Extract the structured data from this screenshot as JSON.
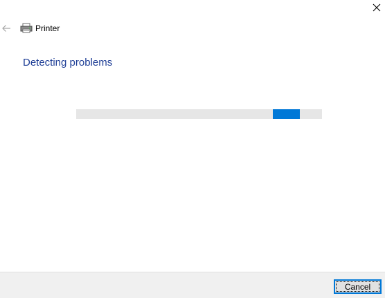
{
  "window": {
    "close_icon": "close-icon",
    "back_icon": "back-arrow-icon",
    "app_icon": "printer-icon",
    "title": "Printer"
  },
  "main": {
    "heading": "Detecting problems",
    "progress": {
      "state": "indeterminate",
      "chunk_position_fraction": 0.8,
      "track_color": "#e6e6e6",
      "fill_color": "#0078d7"
    }
  },
  "footer": {
    "cancel_label": "Cancel"
  },
  "colors": {
    "heading": "#1e3e96",
    "accent": "#0078d7",
    "footer_bg": "#f0f0f0"
  }
}
